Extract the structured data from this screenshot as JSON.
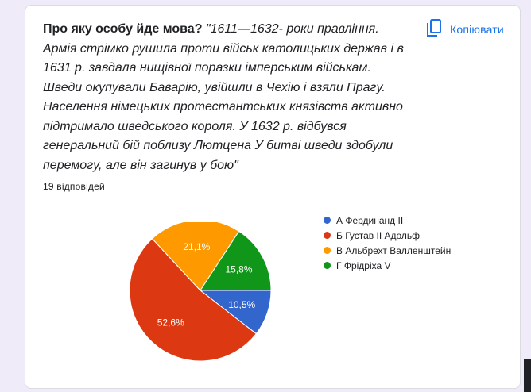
{
  "question": {
    "title": "Про яку особу йде мова?",
    "quote": "\"1611—1632- роки правління. Армія стрімко рушила проти військ католицьких держав і в 1631 р. завдала нищівної поразки імперським військам. Шведи окупували Баварію, увійшли в Чехію і взяли Прагу. Населення німецьких протестантських князівств активно підтримало шведського короля. У 1632 р. відбувся генеральний бій поблизу Лютцена У битві шведи здобули перемогу, але він загинув у бою\""
  },
  "copy_button": {
    "label": "Копіювати",
    "icon": "copy-icon",
    "color": "#1a73e8"
  },
  "responses_count": "19 відповідей",
  "chart_data": {
    "type": "pie",
    "start_angle_deg": 0,
    "slices": [
      {
        "label": "А Фердинанд ІІ",
        "value": 10.5,
        "display": "10,5%",
        "color": "#3366cc"
      },
      {
        "label": "Б Густав ІІ Адольф",
        "value": 52.6,
        "display": "52,6%",
        "color": "#dc3912"
      },
      {
        "label": "В Альбрехт Валленштейн",
        "value": 21.1,
        "display": "21,1%",
        "color": "#ff9900"
      },
      {
        "label": "Г Фрідріха V",
        "value": 15.8,
        "display": "15,8%",
        "color": "#109618"
      }
    ],
    "legend_position": "right"
  }
}
